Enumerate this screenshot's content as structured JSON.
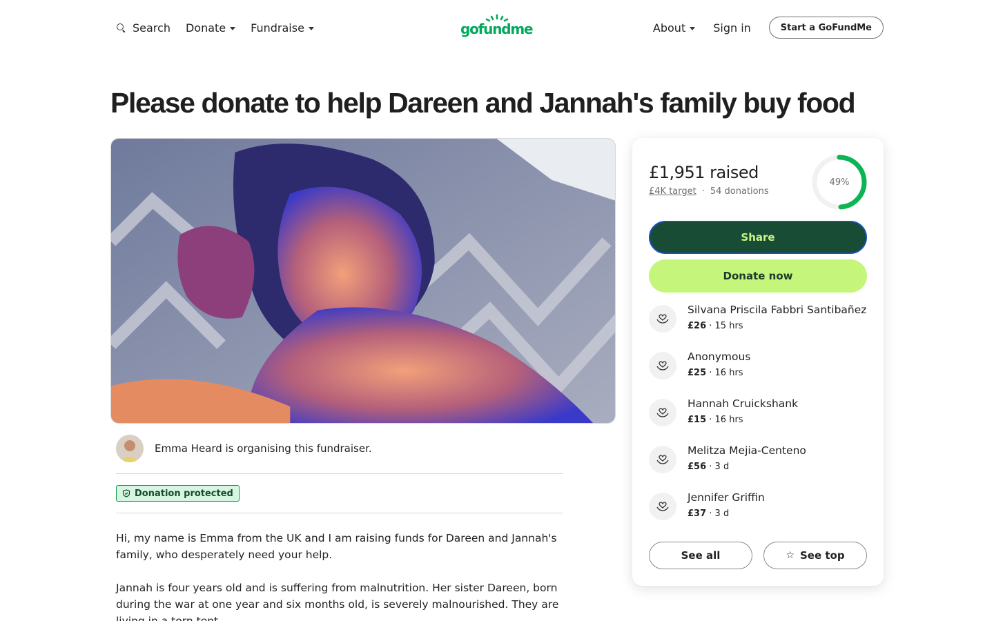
{
  "header": {
    "search_label": "Search",
    "donate_label": "Donate",
    "fundraise_label": "Fundraise",
    "logo_text": "gofundme",
    "about_label": "About",
    "signin_label": "Sign in",
    "start_label": "Start a GoFundMe"
  },
  "campaign": {
    "title": "Please donate to help Dareen and Jannah's family buy food",
    "organiser_text": "Emma Heard is organising this fundraiser.",
    "badge_label": "Donation protected",
    "story": [
      "Hi, my name is Emma from the UK and I am raising funds for Dareen and Jannah's family, who desperately need your help.",
      "Jannah is four years old and is suffering from malnutrition. Her sister Dareen, born during the war at one year and six months old, is severely malnourished. They are living in a torn tent."
    ]
  },
  "stats": {
    "raised": "£1,951 raised",
    "target": "£4K target",
    "separator": "·",
    "donations": "54 donations",
    "percent_label": "49%",
    "percent_value": 49
  },
  "actions": {
    "share_label": "Share",
    "donate_label": "Donate now",
    "see_all_label": "See all",
    "see_top_label": "See top"
  },
  "donors": [
    {
      "name": "Silvana Priscila Fabbri Santibañez",
      "amount": "£26",
      "time": " · 15 hrs"
    },
    {
      "name": "Anonymous",
      "amount": "£25",
      "time": " · 16 hrs"
    },
    {
      "name": "Hannah Cruickshank",
      "amount": "£15",
      "time": " · 16 hrs"
    },
    {
      "name": "Melitza Mejia-Centeno",
      "amount": "£56",
      "time": " · 3 d"
    },
    {
      "name": "Jennifer Griffin",
      "amount": "£37",
      "time": " · 3 d"
    }
  ],
  "colors": {
    "brand_green": "#02a95c",
    "share_bg": "#184c34",
    "share_text": "#c8f68a",
    "donate_bg": "#c6f57c",
    "progress": "#0cb454"
  },
  "icons": {
    "search": "search-icon",
    "caret": "chevron-down-icon",
    "shield": "shield-icon",
    "donor": "heart-hand-icon",
    "star": "star-icon"
  }
}
